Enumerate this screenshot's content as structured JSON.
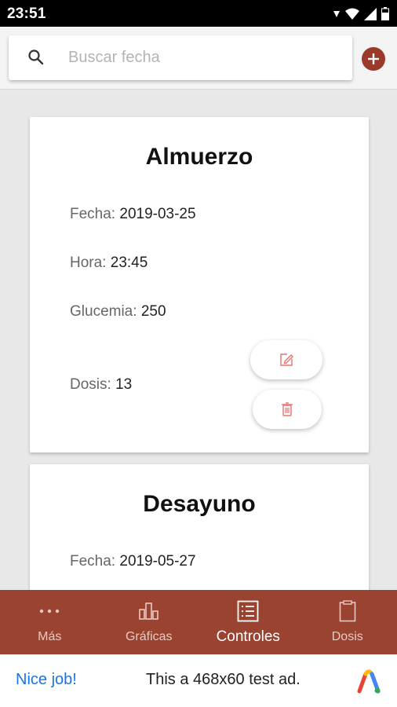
{
  "status_bar": {
    "time": "23:51"
  },
  "search": {
    "placeholder": "Buscar fecha",
    "value": ""
  },
  "cards": [
    {
      "title": "Almuerzo",
      "fecha_label": "Fecha:",
      "fecha": "2019-03-25",
      "hora_label": "Hora:",
      "hora": "23:45",
      "glucemia_label": "Glucemia:",
      "glucemia": "250",
      "dosis_label": "Dosis:",
      "dosis": "13"
    },
    {
      "title": "Desayuno",
      "fecha_label": "Fecha:",
      "fecha": "2019-05-27"
    }
  ],
  "nav": [
    {
      "label": "Más",
      "icon": "more-dots-icon"
    },
    {
      "label": "Gráficas",
      "icon": "bar-chart-icon"
    },
    {
      "label": "Controles",
      "icon": "list-icon",
      "active": true
    },
    {
      "label": "Dosis",
      "icon": "clipboard-icon"
    }
  ],
  "ad": {
    "cta": "Nice job!",
    "text": "This a 468x60 test ad."
  },
  "colors": {
    "brand": "#9b4331",
    "accent_red": "#e57373",
    "ad_blue": "#1a73e8"
  }
}
